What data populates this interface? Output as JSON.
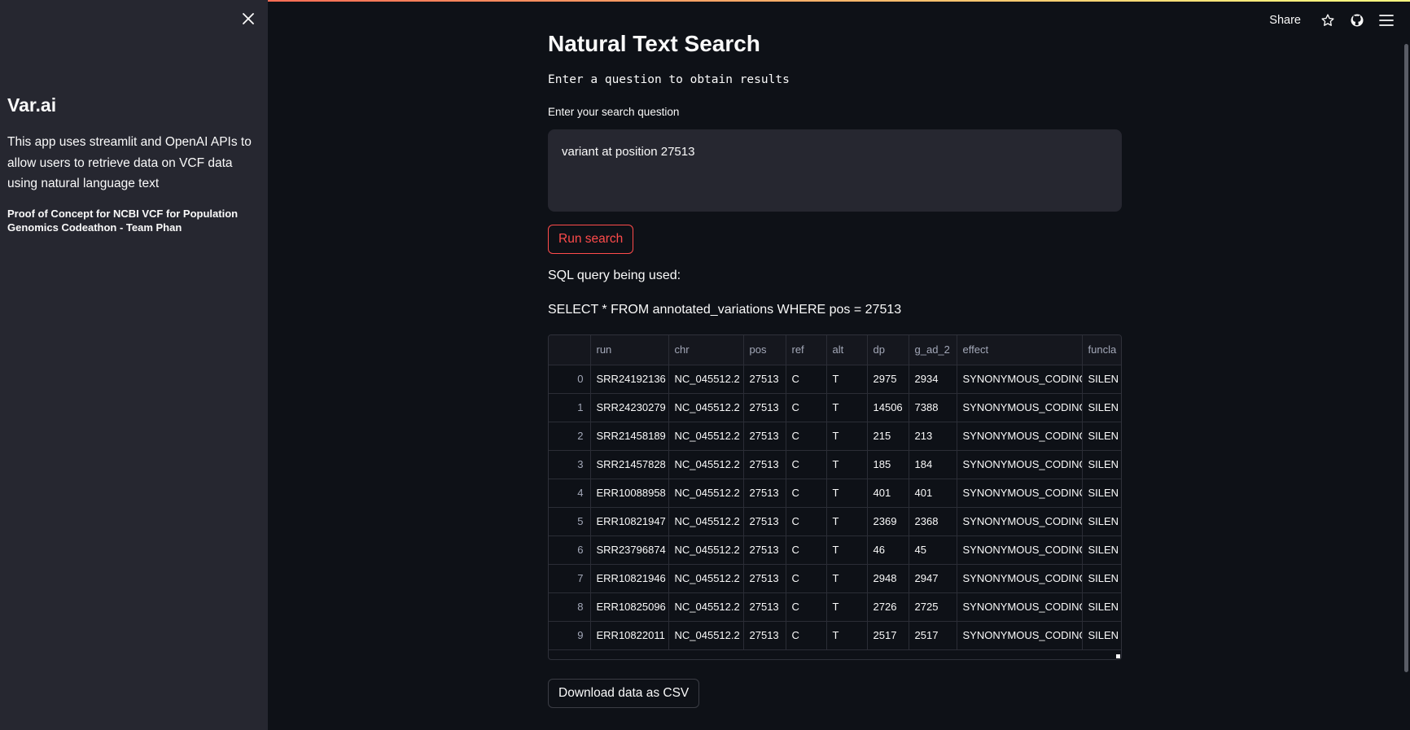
{
  "sidebar": {
    "title": "Var.ai",
    "description": "This app uses streamlit and OpenAI APIs to allow users to retrieve data on VCF data using natural language text",
    "note": "Proof of Concept for NCBI VCF for Population Genomics Codeathon - Team Phan",
    "close_icon": "close-icon"
  },
  "header": {
    "share_label": "Share",
    "icons": [
      "star-icon",
      "github-icon",
      "menu-icon"
    ]
  },
  "main": {
    "title": "Natural Text Search",
    "subtitle": "Enter a question to obtain results",
    "search_label": "Enter your search question",
    "search_value": "variant at position 27513",
    "run_button": "Run search",
    "sql_label": "SQL query being used:",
    "sql_query": "SELECT * FROM annotated_variations WHERE pos = 27513",
    "download_button": "Download data as CSV"
  },
  "table": {
    "columns": [
      "",
      "run",
      "chr",
      "pos",
      "ref",
      "alt",
      "dp",
      "g_ad_2",
      "effect",
      "funcla"
    ],
    "rows": [
      [
        "0",
        "SRR24192136",
        "NC_045512.2",
        "27513",
        "C",
        "T",
        "2975",
        "2934",
        "SYNONYMOUS_CODING",
        "SILEN"
      ],
      [
        "1",
        "SRR24230279",
        "NC_045512.2",
        "27513",
        "C",
        "T",
        "14506",
        "7388",
        "SYNONYMOUS_CODING",
        "SILEN"
      ],
      [
        "2",
        "SRR21458189",
        "NC_045512.2",
        "27513",
        "C",
        "T",
        "215",
        "213",
        "SYNONYMOUS_CODING",
        "SILEN"
      ],
      [
        "3",
        "SRR21457828",
        "NC_045512.2",
        "27513",
        "C",
        "T",
        "185",
        "184",
        "SYNONYMOUS_CODING",
        "SILEN"
      ],
      [
        "4",
        "ERR10088958",
        "NC_045512.2",
        "27513",
        "C",
        "T",
        "401",
        "401",
        "SYNONYMOUS_CODING",
        "SILEN"
      ],
      [
        "5",
        "ERR10821947",
        "NC_045512.2",
        "27513",
        "C",
        "T",
        "2369",
        "2368",
        "SYNONYMOUS_CODING",
        "SILEN"
      ],
      [
        "6",
        "SRR23796874",
        "NC_045512.2",
        "27513",
        "C",
        "T",
        "46",
        "45",
        "SYNONYMOUS_CODING",
        "SILEN"
      ],
      [
        "7",
        "ERR10821946",
        "NC_045512.2",
        "27513",
        "C",
        "T",
        "2948",
        "2947",
        "SYNONYMOUS_CODING",
        "SILEN"
      ],
      [
        "8",
        "ERR10825096",
        "NC_045512.2",
        "27513",
        "C",
        "T",
        "2726",
        "2725",
        "SYNONYMOUS_CODING",
        "SILEN"
      ],
      [
        "9",
        "ERR10822011",
        "NC_045512.2",
        "27513",
        "C",
        "T",
        "2517",
        "2517",
        "SYNONYMOUS_CODING",
        "SILEN"
      ]
    ]
  },
  "colors": {
    "background": "#0e1117",
    "sidebar": "#262730",
    "accent": "#ff4b4b",
    "text": "#fafafa"
  }
}
